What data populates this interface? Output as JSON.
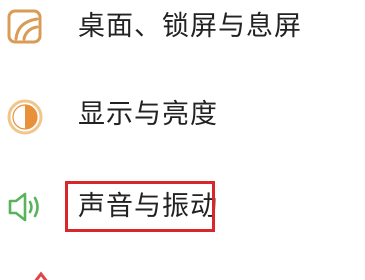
{
  "settings": {
    "items": [
      {
        "label": "桌面、锁屏与息屏",
        "icon": "wallpaper-icon",
        "color": "#d99c56"
      },
      {
        "label": "显示与亮度",
        "icon": "brightness-icon",
        "color": "#e9913a"
      },
      {
        "label": "声音与振动",
        "icon": "speaker-icon",
        "color": "#58b45b"
      }
    ]
  },
  "highlight": {
    "target": "sound-and-vibration",
    "color": "#d9262a"
  }
}
